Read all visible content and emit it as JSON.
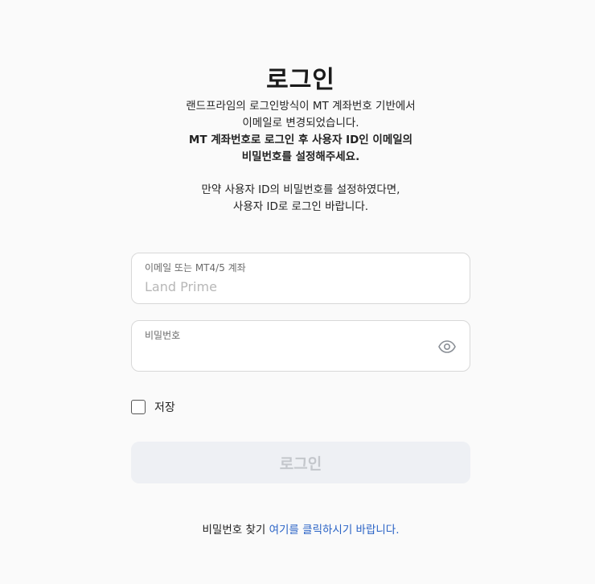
{
  "title": "로그인",
  "description": {
    "line1": "랜드프라임의 로그인방식이 MT 계좌번호 기반에서",
    "line2": "이메일로 변경되었습니다.",
    "bold_line1": "MT 계좌번호로 로그인 후 사용자 ID인 이메일의",
    "bold_line2": "비밀번호를 설정해주세요.",
    "line3": "만약 사용자 ID의 비밀번호를 설정하였다면,",
    "line4": "사용자 ID로 로그인 바랍니다."
  },
  "email_field": {
    "label": "이메일 또는 MT4/5 계좌",
    "placeholder": "Land Prime",
    "value": ""
  },
  "password_field": {
    "label": "비밀번호",
    "placeholder": "",
    "value": "",
    "toggle_icon": "eye-icon"
  },
  "remember": {
    "label": "저장",
    "checked": false
  },
  "login_button": {
    "label": "로그인",
    "bg_color": "#eef0f4",
    "text_color": "#c4c7cc"
  },
  "forgot": {
    "prefix": "비밀번호 찾기",
    "link_text": "여기를 클릭하시기 바랍니다.",
    "link_color": "#2a63c6"
  }
}
